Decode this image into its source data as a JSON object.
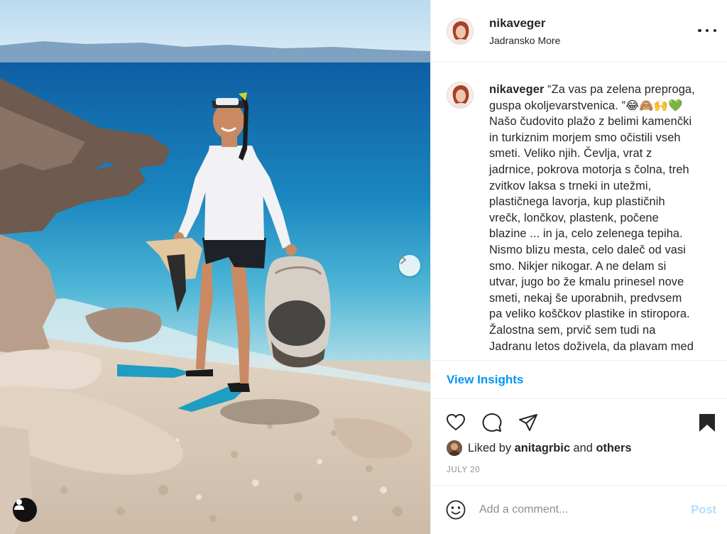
{
  "post": {
    "username": "nikaveger",
    "location": "Jadransko More",
    "caption_username": "nikaveger",
    "caption_lines": [
      "“Za vas pa zelena preproga,",
      "guspa okoljevarstvenica. ”😂🙈🙌💚",
      "Našo čudovito plažo z belimi kamenčki",
      "in turkiznim morjem smo očistili vseh",
      "smeti. Veliko njih. Čevlja, vrat z",
      "jadrnice, pokrova motorja s čolna, treh",
      "zvitkov laksa s trneki in utežmi,",
      "plastičnega lavorja, kup plastičnih",
      "vrečk, lončkov, plastenk, počene",
      "blazine ... in ja, celo zelenega tepiha.",
      "Nismo blizu mesta, celo daleč od vasi",
      "smo. Nikjer nikogar. A ne delam si",
      "utvar, jugo bo že kmalu prinesel nove",
      "smeti, nekaj še uporabnih, predvsem",
      "pa veliko koščkov plastike in stiropora.",
      "Žalostna sem, prvič sem tudi na",
      "Jadranu letos doživela, da plavam med"
    ],
    "insights_label": "View Insights",
    "liked_by_prefix": "Liked by",
    "liked_by_user": "anitagrbic",
    "liked_by_and": "and",
    "liked_by_others": "others",
    "date": "JULY 20",
    "comment_placeholder": "Add a comment...",
    "post_label": "Post"
  },
  "icons": {
    "more": "more-options-icon",
    "like": "heart-icon",
    "comment": "comment-icon",
    "share": "paper-plane-icon",
    "save": "bookmark-icon",
    "emoji": "smiley-icon",
    "next": "chevron-right-icon",
    "tags": "user-tag-icon"
  },
  "colors": {
    "link_blue": "#0095f6",
    "post_disabled": "#b2dffc",
    "secondary_text": "#8e8e8e",
    "border": "#efefef",
    "sea": "#1a7fb8",
    "sky": "#cfe6f5"
  }
}
